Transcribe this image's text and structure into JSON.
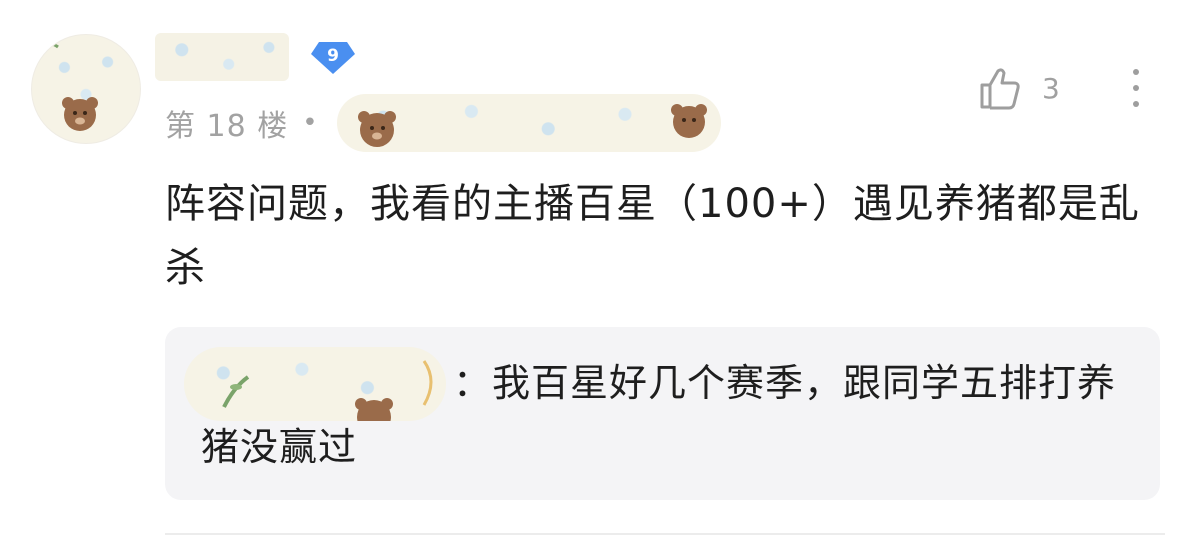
{
  "post": {
    "floor_label": "第 18 楼",
    "separator": "•",
    "level": "9",
    "like_count": "3",
    "comment_text": "阵容问题，我看的主播百星（100+）遇见养猪都是乱杀"
  },
  "reply": {
    "colon": "：",
    "text": "我百星好几个赛季，跟同学五排打养猪没赢过"
  },
  "icons": {
    "like": "thumbs-up-icon",
    "more": "more-vertical-icon",
    "badge": "level-diamond-icon"
  },
  "colors": {
    "badge_blue": "#4a8ff0",
    "muted_text": "#a2a2a2",
    "reply_bg": "#f4f4f6"
  }
}
